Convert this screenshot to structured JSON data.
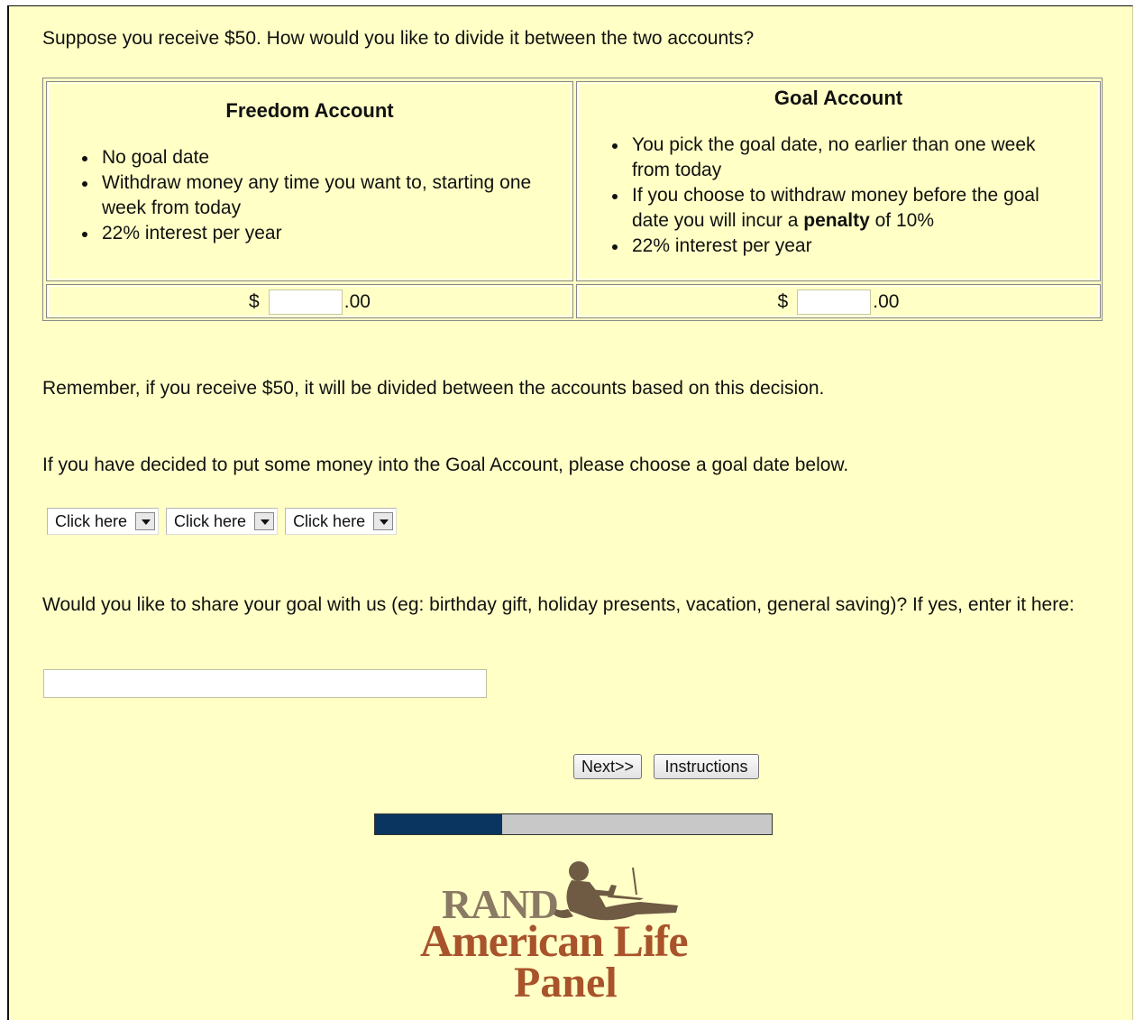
{
  "question": "Suppose you receive $50. How would you like to divide it between the two accounts?",
  "freedom_account": {
    "title": "Freedom Account",
    "features": [
      "No goal date",
      "Withdraw money any time you want to, starting one week from today",
      "22% interest per year"
    ],
    "currency_symbol": "$",
    "amount_value": "",
    "cents_suffix": ".00"
  },
  "goal_account": {
    "title": "Goal Account",
    "feature_1": "You pick the goal date, no earlier than one week from today",
    "feature_2_before": "If you choose to withdraw money before the goal date you will incur a ",
    "feature_2_bold": "penalty",
    "feature_2_after": " of 10%",
    "feature_3": "22% interest per year",
    "currency_symbol": "$",
    "amount_value": "",
    "cents_suffix": ".00"
  },
  "reminder": "Remember, if you receive $50, it will be divided between the accounts based on this decision.",
  "goal_date_prompt": "If you have decided to put some money into the Goal Account, please choose a goal date below.",
  "goal_date_selects": [
    "Click here",
    "Click here",
    "Click here"
  ],
  "share_prompt": "Would you like to share your goal with us (eg: birthday gift, holiday presents, vacation, general saving)? If yes, enter it here:",
  "share_input_value": "",
  "buttons": {
    "next": "Next>>",
    "instructions": "Instructions"
  },
  "progress_fraction": 0.32,
  "colors": {
    "background": "#ffffc6",
    "progress_fill": "#0a3560",
    "progress_track": "#c8c8c8",
    "logo_brown": "#a8532b",
    "logo_gray": "#8a7a64"
  },
  "logo": {
    "line1": "RAND",
    "line2": "American Life",
    "line3": "Panel",
    "icon": "person-with-laptop-icon"
  }
}
